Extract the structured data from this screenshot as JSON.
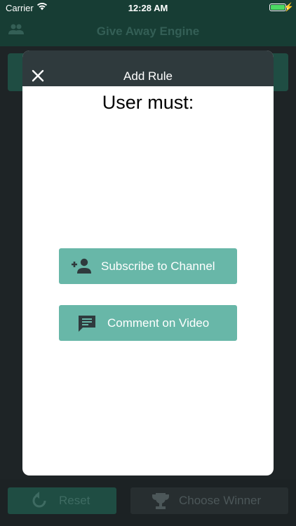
{
  "status_bar": {
    "carrier": "Carrier",
    "time": "12:28 AM"
  },
  "app": {
    "title": "Give Away Engine",
    "reset_label": "Reset",
    "choose_winner_label": "Choose Winner"
  },
  "modal": {
    "title": "Add Rule",
    "heading": "User must:",
    "options": [
      {
        "label": "Subscribe to Channel",
        "icon": "person-add-icon"
      },
      {
        "label": "Comment on Video",
        "icon": "comment-icon"
      }
    ]
  },
  "colors": {
    "accent": "#68b7a8",
    "header": "#2f3a3d",
    "navbar": "#173d34",
    "battery": "#4cd964"
  }
}
